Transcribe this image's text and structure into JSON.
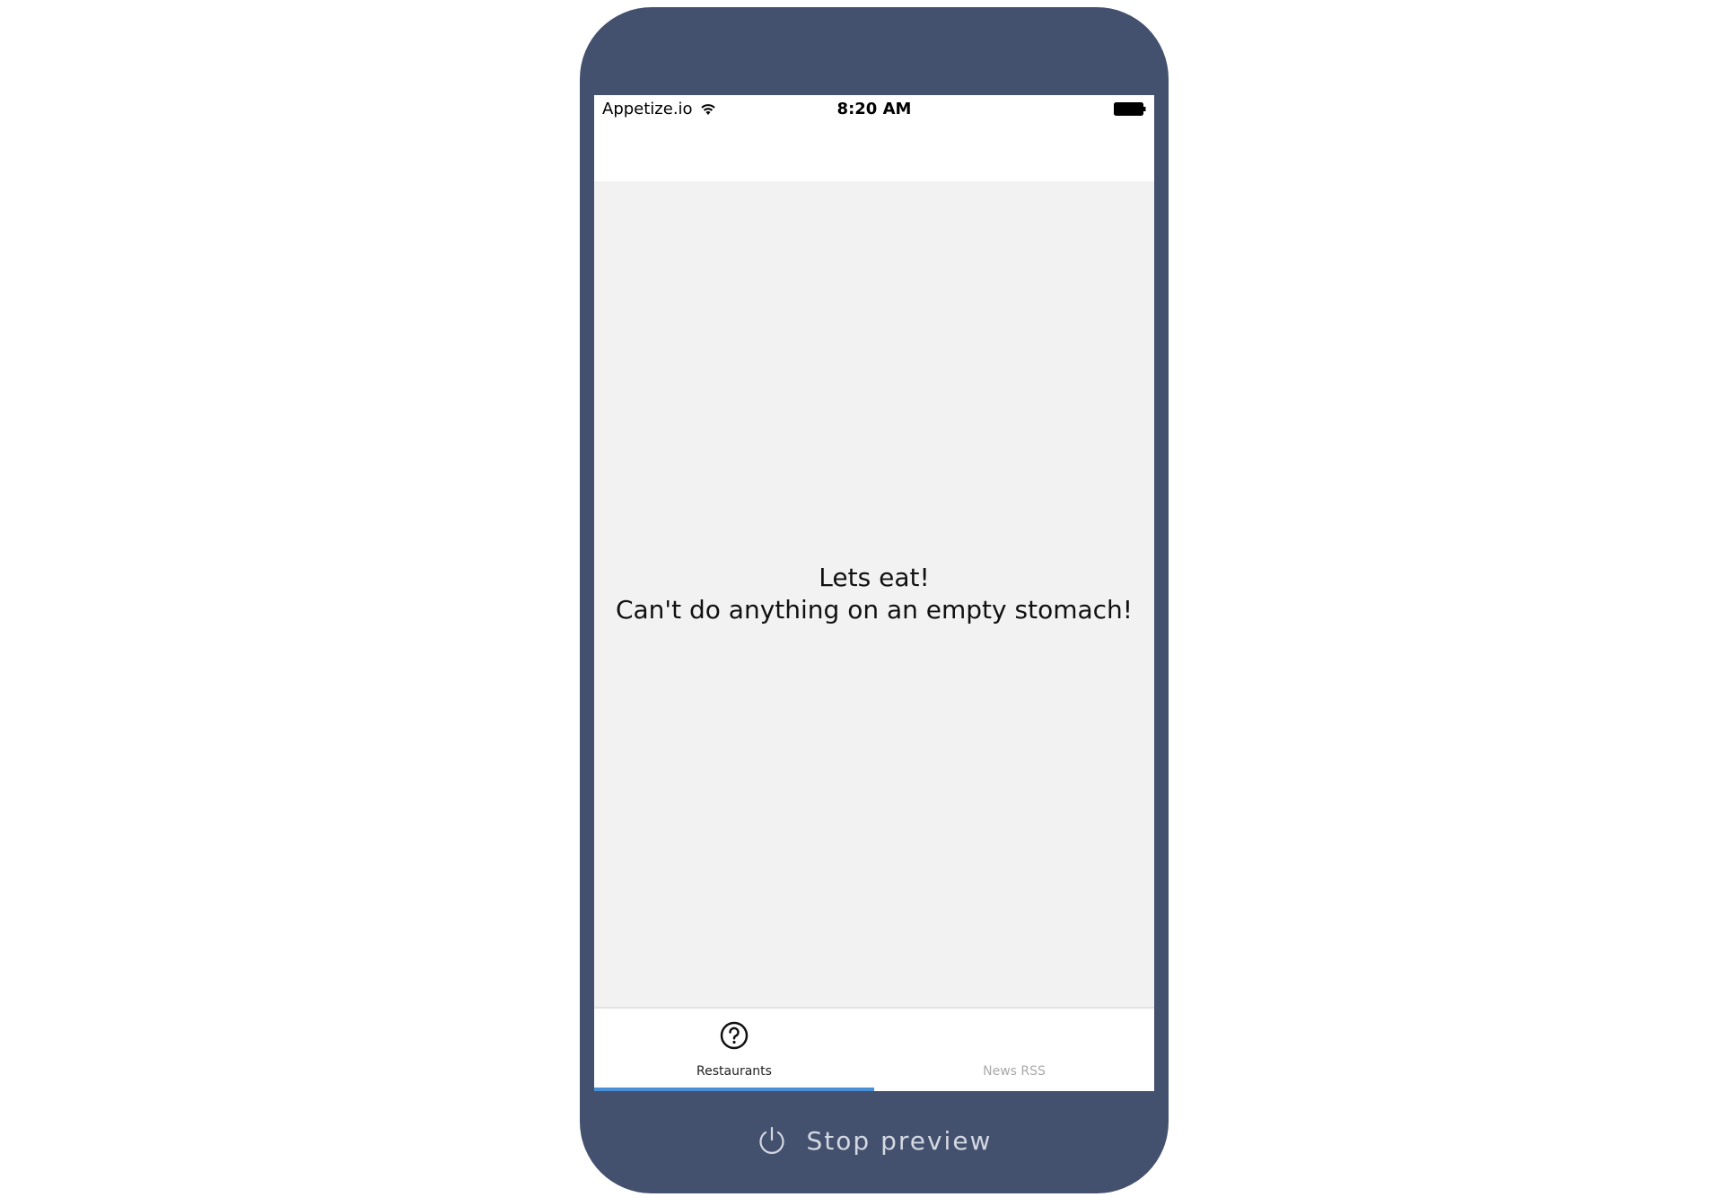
{
  "status_bar": {
    "carrier": "Appetize.io",
    "time": "8:20 AM",
    "wifi_icon": "wifi-icon",
    "battery_icon": "battery-full-icon"
  },
  "content": {
    "line1": "Lets eat!",
    "line2": "Can't do anything on an empty stomach!"
  },
  "tabs": [
    {
      "label": "Restaurants",
      "icon": "question-circle-icon",
      "active": true
    },
    {
      "label": "News RSS",
      "icon": "",
      "active": false
    }
  ],
  "colors": {
    "device_frame": "#43516f",
    "accent": "#4a90d9",
    "content_background": "#f2f2f2"
  },
  "footer": {
    "stop_label": "Stop preview",
    "icon": "power-icon"
  }
}
